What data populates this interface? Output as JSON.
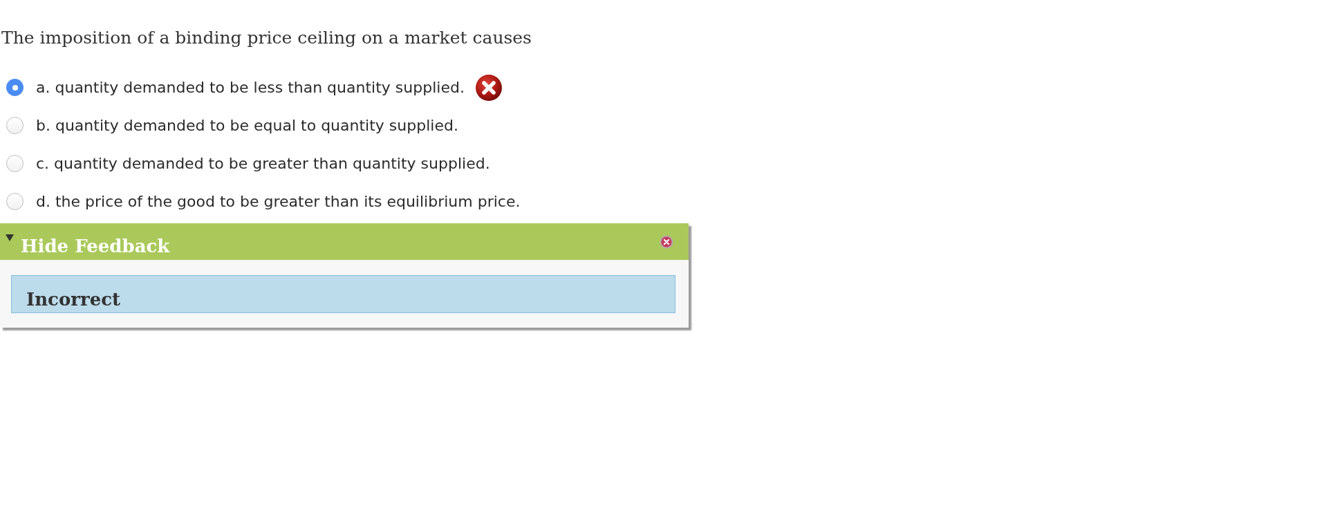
{
  "question": {
    "text": "The imposition of a binding price ceiling on a market causes"
  },
  "options": [
    {
      "label": "a. quantity demanded to be less than quantity supplied.",
      "selected": true,
      "incorrect_mark": true
    },
    {
      "label": "b. quantity demanded to be equal to quantity supplied.",
      "selected": false,
      "incorrect_mark": false
    },
    {
      "label": "c. quantity demanded to be greater than quantity supplied.",
      "selected": false,
      "incorrect_mark": false
    },
    {
      "label": "d. the price of the good to be greater than its equilibrium price.",
      "selected": false,
      "incorrect_mark": false
    }
  ],
  "feedback": {
    "toggle_label": "Hide Feedback",
    "expanded": true,
    "verdict": "Incorrect"
  }
}
